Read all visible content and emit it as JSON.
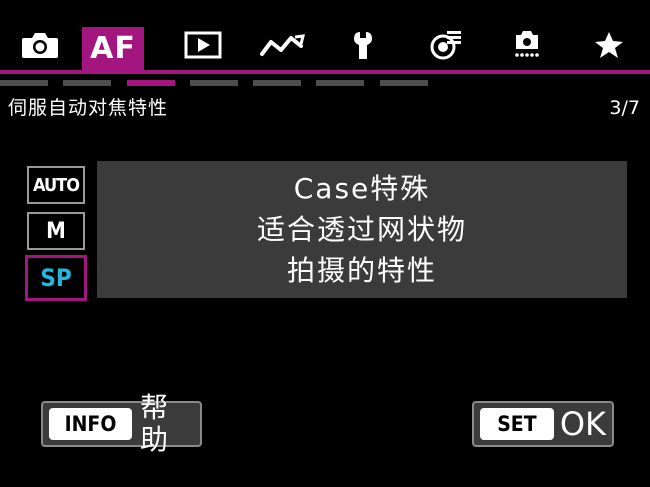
{
  "tabs": [
    {
      "id": "shooting",
      "icon": "camera-icon",
      "label": ""
    },
    {
      "id": "af",
      "icon": "",
      "label": "AF",
      "active": true
    },
    {
      "id": "playback",
      "icon": "play-icon",
      "label": ""
    },
    {
      "id": "wireless",
      "icon": "wireless-icon",
      "label": ""
    },
    {
      "id": "setup",
      "icon": "wrench-icon",
      "label": ""
    },
    {
      "id": "custom-functions",
      "icon": "custom-functions-icon",
      "label": ""
    },
    {
      "id": "sensor",
      "icon": "camera-sensor-icon",
      "label": ""
    },
    {
      "id": "my-menu",
      "icon": "star-icon",
      "label": ""
    }
  ],
  "page_indicator": {
    "count": 7,
    "active_index": 2
  },
  "header": {
    "title": "伺服自动对焦特性",
    "page": "3/7"
  },
  "cases": [
    {
      "id": "auto",
      "label": "AUTO",
      "selected": false
    },
    {
      "id": "m",
      "label": "M",
      "selected": false
    },
    {
      "id": "sp",
      "label": "SP",
      "selected": true
    }
  ],
  "description": {
    "line1": "Case特殊",
    "line2": "适合透过网状物",
    "line3": "拍摄的特性"
  },
  "buttons": {
    "info_key": "INFO",
    "info_label": "帮助",
    "set_key": "SET",
    "set_label": "OK"
  },
  "colors": {
    "accent": "#a4167f",
    "sp_text": "#22b7e0",
    "panel": "#3b3b3b",
    "background": "#000000"
  }
}
